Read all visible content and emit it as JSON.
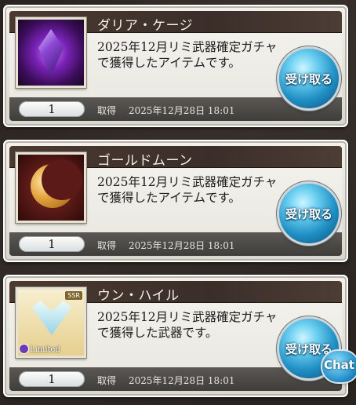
{
  "items": [
    {
      "title": "ダリア・ケージ",
      "description": "2025年12月リミ武器確定ガチャで獲得したアイテムです。",
      "quantity": "1",
      "acquired_label": "取得",
      "acquired_date": "2025年12月28日 18:01",
      "receive_label": "受け取る",
      "thumbnail": "purple-crystal-icon"
    },
    {
      "title": "ゴールドムーン",
      "description": "2025年12月リミ武器確定ガチャで獲得したアイテムです。",
      "quantity": "1",
      "acquired_label": "取得",
      "acquired_date": "2025年12月28日 18:01",
      "receive_label": "受け取る",
      "thumbnail": "gold-moon-icon"
    },
    {
      "title": "ウン・ハイル",
      "description": "2025年12月リミ武器確定ガチャで獲得した武器です。",
      "quantity": "1",
      "acquired_label": "取得",
      "acquired_date": "2025年12月28日 18:01",
      "receive_label": "受け取る",
      "thumbnail": "ice-weapon-icon",
      "rarity": "SSR",
      "badge": "Limited"
    }
  ],
  "chat_label": "Chat",
  "colors": {
    "accent_button": "#1f8fc4",
    "title_bar": "#3b2e29",
    "card_bg": "#f3f1ea"
  }
}
